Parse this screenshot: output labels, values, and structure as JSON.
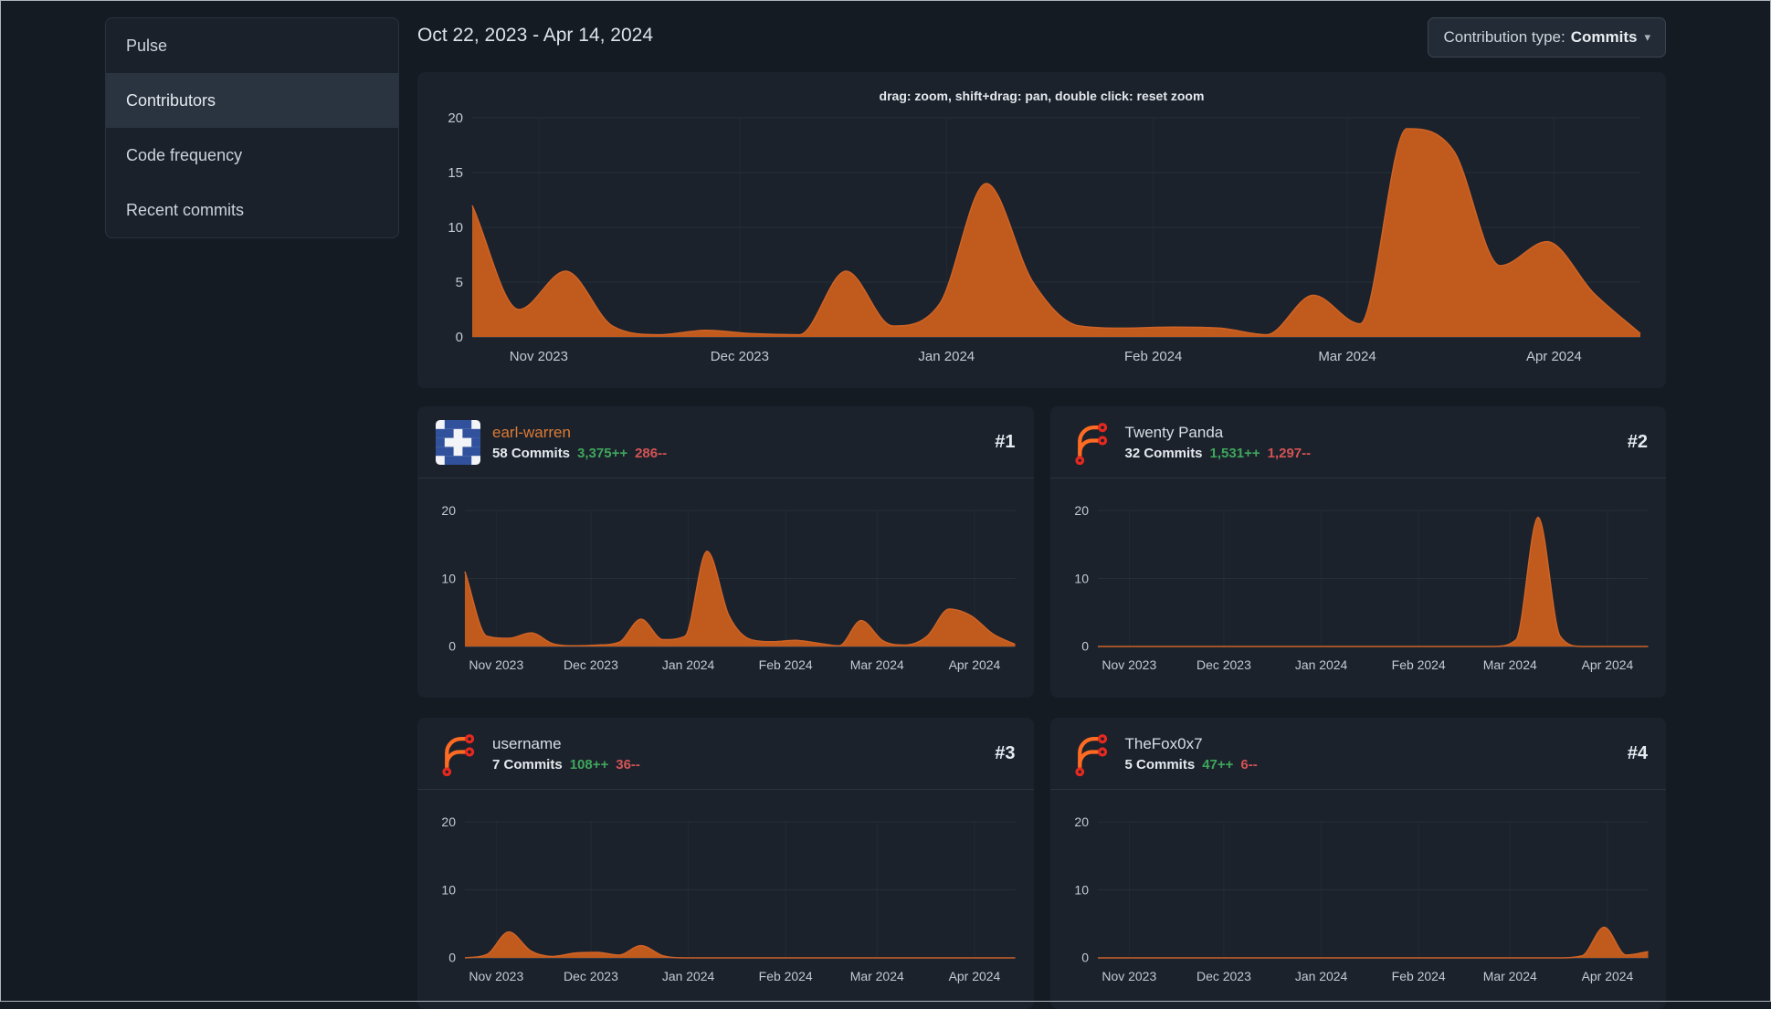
{
  "colors": {
    "area": "#c05b1d",
    "area_line": "#d06326",
    "additions": "#3fa65b",
    "deletions": "#d35454",
    "accent_link": "#dd7a33"
  },
  "sidebar": {
    "items": [
      {
        "label": "Pulse",
        "active": false
      },
      {
        "label": "Contributors",
        "active": true
      },
      {
        "label": "Code frequency",
        "active": false
      },
      {
        "label": "Recent commits",
        "active": false
      }
    ]
  },
  "header": {
    "date_range": "Oct 22, 2023 - Apr 14, 2024",
    "contribution_type": {
      "label": "Contribution type:",
      "value": "Commits",
      "caret": "▾"
    }
  },
  "main_chart": {
    "hint": "drag: zoom, shift+drag: pan, double click: reset zoom"
  },
  "contributors": [
    {
      "rank": "#1",
      "name": "earl-warren",
      "commits": "58 Commits",
      "additions": "3,375++",
      "deletions": "286--",
      "avatar": "identicon"
    },
    {
      "rank": "#2",
      "name": "Twenty Panda",
      "commits": "32 Commits",
      "additions": "1,531++",
      "deletions": "1,297--",
      "avatar": "forgejo-logo"
    },
    {
      "rank": "#3",
      "name": "username",
      "commits": "7 Commits",
      "additions": "108++",
      "deletions": "36--",
      "avatar": "forgejo-logo"
    },
    {
      "rank": "#4",
      "name": "TheFox0x7",
      "commits": "5 Commits",
      "additions": "47++",
      "deletions": "6--",
      "avatar": "forgejo-logo"
    }
  ],
  "charts": {
    "main": {
      "type": "area",
      "ymax": 20,
      "yticks": [
        0,
        5,
        10,
        15,
        20
      ],
      "xticks": [
        {
          "f": 0.057,
          "label": "Nov 2023"
        },
        {
          "f": 0.229,
          "label": "Dec 2023"
        },
        {
          "f": 0.406,
          "label": "Jan 2024"
        },
        {
          "f": 0.583,
          "label": "Feb 2024"
        },
        {
          "f": 0.749,
          "label": "Mar 2024"
        },
        {
          "f": 0.926,
          "label": "Apr 2024"
        }
      ],
      "values": [
        12,
        2.5,
        6,
        1,
        0.2,
        0.6,
        0.3,
        0.2,
        6,
        1,
        3,
        14,
        5,
        1,
        0.8,
        0.9,
        0.8,
        0.2,
        3.8,
        1.2,
        19,
        17,
        6.5,
        8.7,
        4,
        0.3
      ]
    },
    "contributor_1": {
      "type": "area",
      "ymax": 20,
      "yticks": [
        0,
        10,
        20
      ],
      "xticks": [
        {
          "f": 0.057,
          "label": "Nov 2023"
        },
        {
          "f": 0.229,
          "label": "Dec 2023"
        },
        {
          "f": 0.406,
          "label": "Jan 2024"
        },
        {
          "f": 0.583,
          "label": "Feb 2024"
        },
        {
          "f": 0.749,
          "label": "Mar 2024"
        },
        {
          "f": 0.926,
          "label": "Apr 2024"
        }
      ],
      "values": [
        11,
        1.5,
        1.2,
        2,
        0.4,
        0.1,
        0.2,
        0.6,
        4,
        1,
        1.5,
        14,
        4.5,
        1,
        0.7,
        0.9,
        0.5,
        0.1,
        3.8,
        0.8,
        0.2,
        1.5,
        5.5,
        4.5,
        1.8,
        0.3
      ]
    },
    "contributor_2": {
      "type": "area",
      "ymax": 20,
      "yticks": [
        0,
        10,
        20
      ],
      "xticks": [
        {
          "f": 0.057,
          "label": "Nov 2023"
        },
        {
          "f": 0.229,
          "label": "Dec 2023"
        },
        {
          "f": 0.406,
          "label": "Jan 2024"
        },
        {
          "f": 0.583,
          "label": "Feb 2024"
        },
        {
          "f": 0.749,
          "label": "Mar 2024"
        },
        {
          "f": 0.926,
          "label": "Apr 2024"
        }
      ],
      "values": [
        0,
        0,
        0,
        0,
        0,
        0,
        0,
        0,
        0,
        0,
        0,
        0,
        0,
        0,
        0,
        0,
        0,
        0,
        0,
        1,
        19,
        1.5,
        0,
        0,
        0,
        0
      ]
    },
    "contributor_3": {
      "type": "area",
      "ymax": 20,
      "yticks": [
        0,
        10,
        20
      ],
      "xticks": [
        {
          "f": 0.057,
          "label": "Nov 2023"
        },
        {
          "f": 0.229,
          "label": "Dec 2023"
        },
        {
          "f": 0.406,
          "label": "Jan 2024"
        },
        {
          "f": 0.583,
          "label": "Feb 2024"
        },
        {
          "f": 0.749,
          "label": "Mar 2024"
        },
        {
          "f": 0.926,
          "label": "Apr 2024"
        }
      ],
      "values": [
        0,
        0.5,
        3.8,
        1,
        0.2,
        0.7,
        0.8,
        0.4,
        1.8,
        0.3,
        0,
        0,
        0,
        0,
        0,
        0,
        0,
        0,
        0,
        0,
        0,
        0,
        0,
        0,
        0,
        0
      ]
    },
    "contributor_4": {
      "type": "area",
      "ymax": 20,
      "yticks": [
        0,
        10,
        20
      ],
      "xticks": [
        {
          "f": 0.057,
          "label": "Nov 2023"
        },
        {
          "f": 0.229,
          "label": "Dec 2023"
        },
        {
          "f": 0.406,
          "label": "Jan 2024"
        },
        {
          "f": 0.583,
          "label": "Feb 2024"
        },
        {
          "f": 0.749,
          "label": "Mar 2024"
        },
        {
          "f": 0.926,
          "label": "Apr 2024"
        }
      ],
      "values": [
        0,
        0,
        0,
        0,
        0,
        0,
        0,
        0,
        0,
        0,
        0,
        0,
        0,
        0,
        0,
        0,
        0,
        0,
        0,
        0,
        0,
        0,
        0.3,
        4.5,
        0.4,
        0.9
      ]
    }
  }
}
